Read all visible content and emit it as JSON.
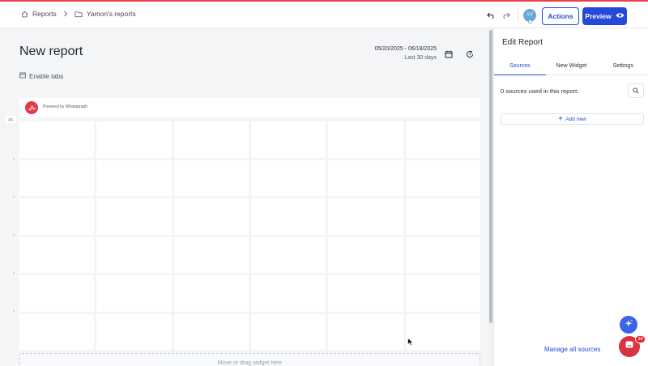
{
  "topbar": {
    "breadcrumbs": [
      {
        "icon": "home-icon",
        "label": "Reports"
      },
      {
        "icon": "folder-icon",
        "label": "Yamon's reports"
      }
    ],
    "avatar_initials": "YY",
    "actions_label": "Actions",
    "preview_label": "Preview"
  },
  "report": {
    "title": "New report",
    "date_range": "05/20/2025 - 06/18/2025",
    "date_preset": "Last 30 days",
    "enable_tabs_label": "Enable tabs",
    "powered_by": "Powered by Whatagraph",
    "page_indicator": "1/1",
    "dropzone_text": "Move or drag widget here"
  },
  "panel": {
    "title": "Edit Report",
    "tabs": [
      "Sources",
      "New Widget",
      "Settings"
    ],
    "active_tab": "Sources",
    "sources_count_text": "0 sources used in this report:",
    "add_new_label": "Add new",
    "manage_label": "Manage all sources"
  },
  "chat": {
    "badge_count": "10"
  },
  "colors": {
    "accent": "#2549d8",
    "brand_red": "#e53945",
    "canvas_bg": "#f4f5f7"
  }
}
